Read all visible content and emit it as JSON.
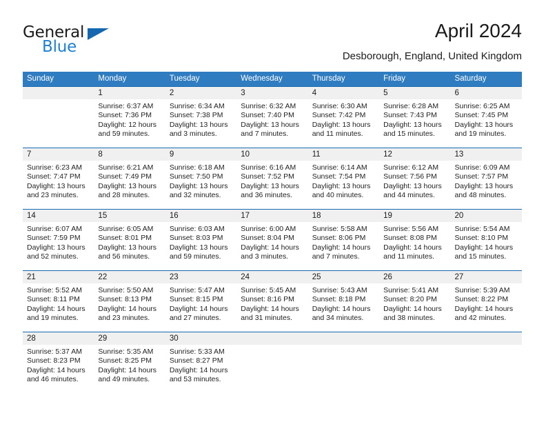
{
  "brand": {
    "word1": "General",
    "word2": "Blue",
    "triangle_color": "#1567b0",
    "blue_text_color": "#1f7fd0"
  },
  "header": {
    "title": "April 2024",
    "location": "Desborough, England, United Kingdom"
  },
  "theme": {
    "header_blue": "#2f7cc0",
    "separator_blue": "#1567b0",
    "daynum_band": "#f0f0f0"
  },
  "weekdays": [
    "Sunday",
    "Monday",
    "Tuesday",
    "Wednesday",
    "Thursday",
    "Friday",
    "Saturday"
  ],
  "weeks": [
    {
      "days": [
        {
          "num": "",
          "sunrise": "",
          "sunset": "",
          "daylight1": "",
          "daylight2": ""
        },
        {
          "num": "1",
          "sunrise": "Sunrise: 6:37 AM",
          "sunset": "Sunset: 7:36 PM",
          "daylight1": "Daylight: 12 hours",
          "daylight2": "and 59 minutes."
        },
        {
          "num": "2",
          "sunrise": "Sunrise: 6:34 AM",
          "sunset": "Sunset: 7:38 PM",
          "daylight1": "Daylight: 13 hours",
          "daylight2": "and 3 minutes."
        },
        {
          "num": "3",
          "sunrise": "Sunrise: 6:32 AM",
          "sunset": "Sunset: 7:40 PM",
          "daylight1": "Daylight: 13 hours",
          "daylight2": "and 7 minutes."
        },
        {
          "num": "4",
          "sunrise": "Sunrise: 6:30 AM",
          "sunset": "Sunset: 7:42 PM",
          "daylight1": "Daylight: 13 hours",
          "daylight2": "and 11 minutes."
        },
        {
          "num": "5",
          "sunrise": "Sunrise: 6:28 AM",
          "sunset": "Sunset: 7:43 PM",
          "daylight1": "Daylight: 13 hours",
          "daylight2": "and 15 minutes."
        },
        {
          "num": "6",
          "sunrise": "Sunrise: 6:25 AM",
          "sunset": "Sunset: 7:45 PM",
          "daylight1": "Daylight: 13 hours",
          "daylight2": "and 19 minutes."
        }
      ]
    },
    {
      "days": [
        {
          "num": "7",
          "sunrise": "Sunrise: 6:23 AM",
          "sunset": "Sunset: 7:47 PM",
          "daylight1": "Daylight: 13 hours",
          "daylight2": "and 23 minutes."
        },
        {
          "num": "8",
          "sunrise": "Sunrise: 6:21 AM",
          "sunset": "Sunset: 7:49 PM",
          "daylight1": "Daylight: 13 hours",
          "daylight2": "and 28 minutes."
        },
        {
          "num": "9",
          "sunrise": "Sunrise: 6:18 AM",
          "sunset": "Sunset: 7:50 PM",
          "daylight1": "Daylight: 13 hours",
          "daylight2": "and 32 minutes."
        },
        {
          "num": "10",
          "sunrise": "Sunrise: 6:16 AM",
          "sunset": "Sunset: 7:52 PM",
          "daylight1": "Daylight: 13 hours",
          "daylight2": "and 36 minutes."
        },
        {
          "num": "11",
          "sunrise": "Sunrise: 6:14 AM",
          "sunset": "Sunset: 7:54 PM",
          "daylight1": "Daylight: 13 hours",
          "daylight2": "and 40 minutes."
        },
        {
          "num": "12",
          "sunrise": "Sunrise: 6:12 AM",
          "sunset": "Sunset: 7:56 PM",
          "daylight1": "Daylight: 13 hours",
          "daylight2": "and 44 minutes."
        },
        {
          "num": "13",
          "sunrise": "Sunrise: 6:09 AM",
          "sunset": "Sunset: 7:57 PM",
          "daylight1": "Daylight: 13 hours",
          "daylight2": "and 48 minutes."
        }
      ]
    },
    {
      "days": [
        {
          "num": "14",
          "sunrise": "Sunrise: 6:07 AM",
          "sunset": "Sunset: 7:59 PM",
          "daylight1": "Daylight: 13 hours",
          "daylight2": "and 52 minutes."
        },
        {
          "num": "15",
          "sunrise": "Sunrise: 6:05 AM",
          "sunset": "Sunset: 8:01 PM",
          "daylight1": "Daylight: 13 hours",
          "daylight2": "and 56 minutes."
        },
        {
          "num": "16",
          "sunrise": "Sunrise: 6:03 AM",
          "sunset": "Sunset: 8:03 PM",
          "daylight1": "Daylight: 13 hours",
          "daylight2": "and 59 minutes."
        },
        {
          "num": "17",
          "sunrise": "Sunrise: 6:00 AM",
          "sunset": "Sunset: 8:04 PM",
          "daylight1": "Daylight: 14 hours",
          "daylight2": "and 3 minutes."
        },
        {
          "num": "18",
          "sunrise": "Sunrise: 5:58 AM",
          "sunset": "Sunset: 8:06 PM",
          "daylight1": "Daylight: 14 hours",
          "daylight2": "and 7 minutes."
        },
        {
          "num": "19",
          "sunrise": "Sunrise: 5:56 AM",
          "sunset": "Sunset: 8:08 PM",
          "daylight1": "Daylight: 14 hours",
          "daylight2": "and 11 minutes."
        },
        {
          "num": "20",
          "sunrise": "Sunrise: 5:54 AM",
          "sunset": "Sunset: 8:10 PM",
          "daylight1": "Daylight: 14 hours",
          "daylight2": "and 15 minutes."
        }
      ]
    },
    {
      "days": [
        {
          "num": "21",
          "sunrise": "Sunrise: 5:52 AM",
          "sunset": "Sunset: 8:11 PM",
          "daylight1": "Daylight: 14 hours",
          "daylight2": "and 19 minutes."
        },
        {
          "num": "22",
          "sunrise": "Sunrise: 5:50 AM",
          "sunset": "Sunset: 8:13 PM",
          "daylight1": "Daylight: 14 hours",
          "daylight2": "and 23 minutes."
        },
        {
          "num": "23",
          "sunrise": "Sunrise: 5:47 AM",
          "sunset": "Sunset: 8:15 PM",
          "daylight1": "Daylight: 14 hours",
          "daylight2": "and 27 minutes."
        },
        {
          "num": "24",
          "sunrise": "Sunrise: 5:45 AM",
          "sunset": "Sunset: 8:16 PM",
          "daylight1": "Daylight: 14 hours",
          "daylight2": "and 31 minutes."
        },
        {
          "num": "25",
          "sunrise": "Sunrise: 5:43 AM",
          "sunset": "Sunset: 8:18 PM",
          "daylight1": "Daylight: 14 hours",
          "daylight2": "and 34 minutes."
        },
        {
          "num": "26",
          "sunrise": "Sunrise: 5:41 AM",
          "sunset": "Sunset: 8:20 PM",
          "daylight1": "Daylight: 14 hours",
          "daylight2": "and 38 minutes."
        },
        {
          "num": "27",
          "sunrise": "Sunrise: 5:39 AM",
          "sunset": "Sunset: 8:22 PM",
          "daylight1": "Daylight: 14 hours",
          "daylight2": "and 42 minutes."
        }
      ]
    },
    {
      "days": [
        {
          "num": "28",
          "sunrise": "Sunrise: 5:37 AM",
          "sunset": "Sunset: 8:23 PM",
          "daylight1": "Daylight: 14 hours",
          "daylight2": "and 46 minutes."
        },
        {
          "num": "29",
          "sunrise": "Sunrise: 5:35 AM",
          "sunset": "Sunset: 8:25 PM",
          "daylight1": "Daylight: 14 hours",
          "daylight2": "and 49 minutes."
        },
        {
          "num": "30",
          "sunrise": "Sunrise: 5:33 AM",
          "sunset": "Sunset: 8:27 PM",
          "daylight1": "Daylight: 14 hours",
          "daylight2": "and 53 minutes."
        },
        {
          "num": "",
          "sunrise": "",
          "sunset": "",
          "daylight1": "",
          "daylight2": ""
        },
        {
          "num": "",
          "sunrise": "",
          "sunset": "",
          "daylight1": "",
          "daylight2": ""
        },
        {
          "num": "",
          "sunrise": "",
          "sunset": "",
          "daylight1": "",
          "daylight2": ""
        },
        {
          "num": "",
          "sunrise": "",
          "sunset": "",
          "daylight1": "",
          "daylight2": ""
        }
      ]
    }
  ]
}
